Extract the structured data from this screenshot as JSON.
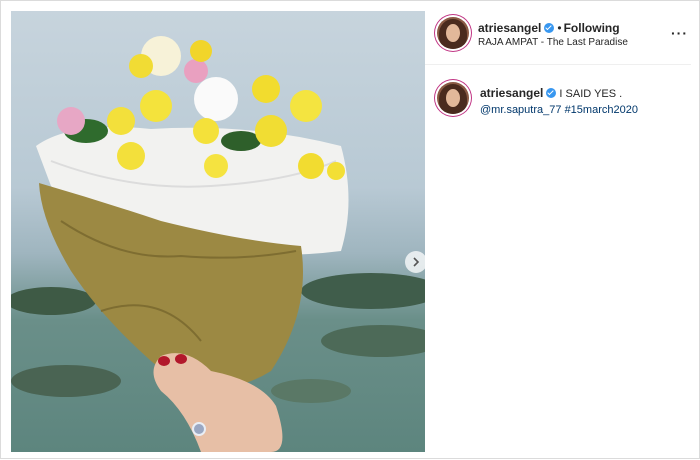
{
  "post": {
    "username": "atriesangel",
    "follow_label": "Following",
    "separator": "•",
    "location": "RAJA AMPAT - The Last Paradise",
    "more_label": "···",
    "caption": {
      "username": "atriesangel",
      "text": " I SAID YES .",
      "mention": "@mr.saputra_77",
      "hashtag": "#15march2020"
    }
  },
  "icons": {
    "verified": "verified-badge-icon",
    "next": "chevron-right-icon",
    "more": "more-options-icon"
  },
  "colors": {
    "verified": "#3897f0",
    "link": "#00376b",
    "story_ring": "#c13584"
  }
}
